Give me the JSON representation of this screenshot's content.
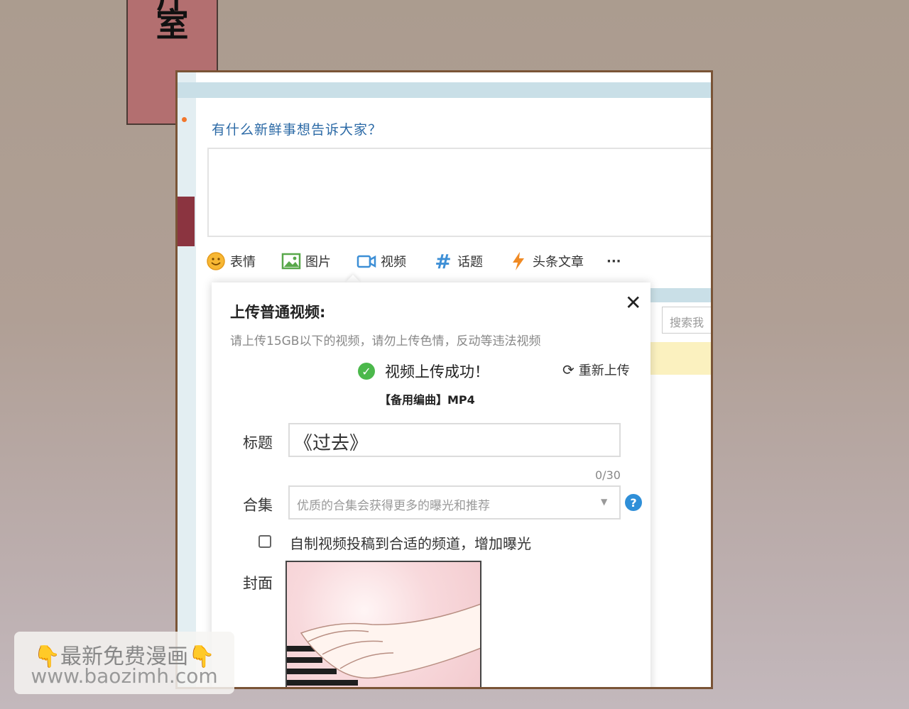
{
  "banner": {
    "title_char_top": "斤",
    "title_char": "室"
  },
  "composer": {
    "prompt": "有什么新鲜事想告诉大家？",
    "toolbar": [
      {
        "label": "表情",
        "icon": "smile-icon"
      },
      {
        "label": "图片",
        "icon": "image-icon"
      },
      {
        "label": "视频",
        "icon": "video-icon"
      },
      {
        "label": "话题",
        "icon": "hashtag-icon"
      },
      {
        "label": "头条文章",
        "icon": "lightning-icon"
      },
      {
        "label": "···",
        "icon": "more-icon"
      }
    ],
    "search_placeholder": "搜索我"
  },
  "dialog": {
    "title": "上传普通视频:",
    "close": "✕",
    "note": "请上传15GB以下的视频，请勿上传色情，反动等违法视频",
    "success": "视频上传成功！",
    "reupload": "重新上传",
    "filename": "【备用编曲】MP4",
    "title_label": "标题",
    "title_value": "《过去》",
    "title_count": "0/30",
    "collection_label": "合集",
    "collection_placeholder": "优质的合集会获得更多的曝光和推荐",
    "checkbox_label": "自制视频投稿到合适的频道，增加曝光",
    "cover_label": "封面"
  },
  "watermark": {
    "line1": "👇最新免费漫画👇",
    "line2": "www.baozimh.com"
  },
  "colors": {
    "accent_blue": "#2c6aa6",
    "success_green": "#4bb84b",
    "frame_brown": "#7a5436",
    "title_red": "#b36f70"
  }
}
